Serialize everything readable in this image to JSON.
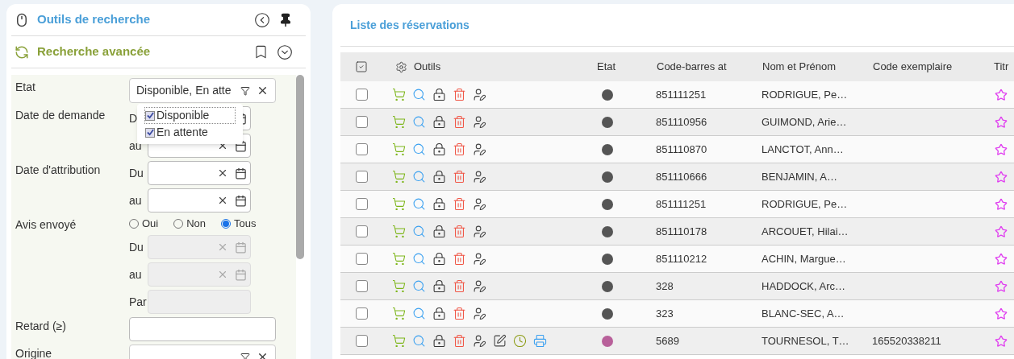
{
  "search_panel": {
    "title": "Outils de recherche",
    "section_title": "Recherche avancée",
    "fields": [
      {
        "kind": "select",
        "label": "Etat",
        "value": "Disponible, En atte"
      },
      {
        "kind": "date",
        "label": "Date de demande",
        "sub_label": "D",
        "disabled": false
      },
      {
        "kind": "date",
        "sub_label": "au",
        "disabled": false
      },
      {
        "kind": "date",
        "label": "Date d'attribution",
        "sub_label": "Du",
        "disabled": false
      },
      {
        "kind": "date",
        "sub_label": "au",
        "disabled": false
      },
      {
        "kind": "radio",
        "label": "Avis envoyé",
        "options": [
          {
            "label": "Oui",
            "selected": false
          },
          {
            "label": "Non",
            "selected": false
          },
          {
            "label": "Tous",
            "selected": true
          }
        ]
      },
      {
        "kind": "date",
        "sub_label": "Du",
        "disabled": true
      },
      {
        "kind": "date",
        "sub_label": "au",
        "disabled": true
      },
      {
        "kind": "text",
        "sub_label": "Par",
        "disabled": true
      },
      {
        "kind": "text",
        "label": "Retard (≥)",
        "disabled": false
      },
      {
        "kind": "select",
        "label": "Origine"
      }
    ],
    "dropdown": {
      "options": [
        {
          "label": "Disponible",
          "checked": true,
          "focused": true
        },
        {
          "label": "En attente",
          "checked": true,
          "focused": false
        }
      ]
    }
  },
  "reservations": {
    "title": "Liste des réservations",
    "columns": [
      "Outils",
      "Etat",
      "Code-barres at",
      "Nom et Prénom",
      "Code exemplaire",
      "Titr"
    ],
    "rows": [
      {
        "selected": false,
        "extra_tools": false,
        "color": "#555555",
        "barcode": "851111251",
        "name": "RODRIGUE, Pe…"
      },
      {
        "selected": false,
        "extra_tools": false,
        "color": "#555555",
        "barcode": "851110956",
        "name": "GUIMOND, Arie…"
      },
      {
        "selected": false,
        "extra_tools": false,
        "color": "#555555",
        "barcode": "851110870",
        "name": "LANCTOT, Ann…"
      },
      {
        "selected": false,
        "extra_tools": false,
        "color": "#555555",
        "barcode": "851110666",
        "name": "BENJAMIN, A…"
      },
      {
        "selected": false,
        "extra_tools": false,
        "color": "#555555",
        "barcode": "851111251",
        "name": "RODRIGUE, Pe…"
      },
      {
        "selected": false,
        "extra_tools": false,
        "color": "#555555",
        "barcode": "851110178",
        "name": "ARCOUET, Hilai…"
      },
      {
        "selected": false,
        "extra_tools": false,
        "color": "#555555",
        "barcode": "851110212",
        "name": "ACHIN, Margue…"
      },
      {
        "selected": false,
        "extra_tools": false,
        "color": "#555555",
        "barcode": "328",
        "name": "HADDOCK, Arc…"
      },
      {
        "selected": false,
        "extra_tools": false,
        "color": "#555555",
        "barcode": "323",
        "name": "BLANC-SEC, A…"
      },
      {
        "selected": false,
        "extra_tools": true,
        "color": "#b8609a",
        "barcode": "5689",
        "name": "TOURNESOL, T…",
        "item_code": "165520338211"
      }
    ]
  }
}
